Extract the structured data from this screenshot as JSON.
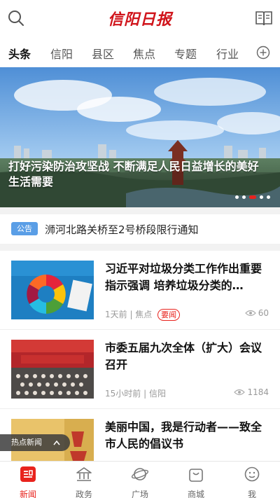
{
  "header": {
    "logo_text": "信阳日报",
    "search_icon": "search-icon",
    "book_icon": "book-icon"
  },
  "tabs": [
    {
      "label": "头条",
      "active": true
    },
    {
      "label": "信阳",
      "active": false
    },
    {
      "label": "县区",
      "active": false
    },
    {
      "label": "焦点",
      "active": false
    },
    {
      "label": "专题",
      "active": false
    },
    {
      "label": "行业",
      "active": false
    }
  ],
  "hero": {
    "caption": "打好污染防治攻坚战 不断满足人民日益增长的美好生活需要",
    "slides": 5,
    "active_slide": 3
  },
  "notice": {
    "badge": "公告",
    "text": "浉河北路关桥至2号桥段限行通知"
  },
  "news": [
    {
      "title": "习近平对垃圾分类工作作出重要指示强调 培养垃圾分类的…",
      "meta": "1天前 | 焦点",
      "tag": "要闻",
      "views": "60"
    },
    {
      "title": "市委五届九次全体（扩大）会议召开",
      "meta": "15小时前 | 信阳",
      "tag": "",
      "views": "1184"
    },
    {
      "title": "美丽中国，我是行动者——致全市人民的倡议书",
      "meta": "",
      "tag": "",
      "views": ""
    }
  ],
  "hotbar": {
    "label": "热点新闻"
  },
  "bottom_nav": [
    {
      "label": "新闻",
      "active": true
    },
    {
      "label": "政务",
      "active": false
    },
    {
      "label": "广场",
      "active": false
    },
    {
      "label": "商城",
      "active": false
    },
    {
      "label": "我",
      "active": false
    }
  ],
  "colors": {
    "brand": "#d0141b",
    "accent": "#e8231d",
    "notice_badge": "#5a9ee6"
  }
}
